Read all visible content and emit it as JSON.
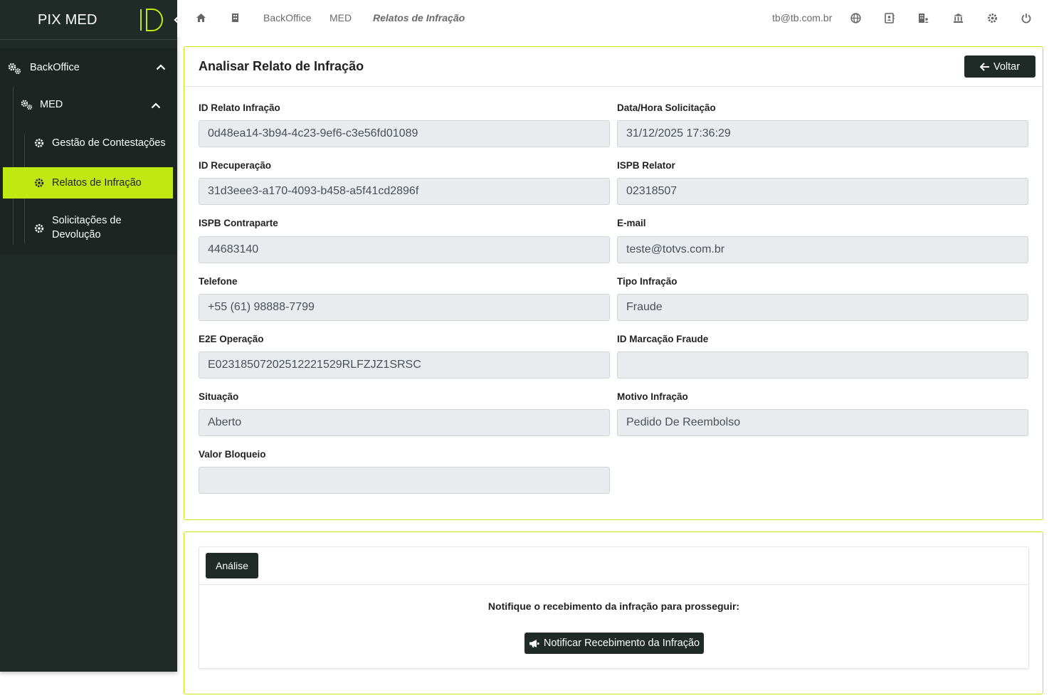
{
  "app": {
    "title": "PIX MED"
  },
  "sidebar": {
    "groups": [
      {
        "label": "BackOffice",
        "icon": "gears-icon",
        "expanded": true,
        "children": [
          {
            "label": "MED",
            "icon": "gears-icon",
            "expanded": true,
            "items": [
              {
                "label": "Gestão de Contestações",
                "icon": "gear-icon",
                "active": false
              },
              {
                "label": "Relatos de Infração",
                "icon": "gear-icon",
                "active": true
              },
              {
                "label": "Solicitações de Devolução",
                "icon": "gear-icon",
                "active": false
              }
            ]
          }
        ]
      }
    ]
  },
  "topbar": {
    "breadcrumb": [
      "BackOffice",
      "MED",
      "Relatos de Infração"
    ],
    "user_email": "tb@tb.com.br",
    "icons": [
      "home-icon",
      "building-icon",
      "globe-icon",
      "contact-icon",
      "company-icon",
      "bank-icon",
      "gear-icon",
      "power-icon"
    ]
  },
  "detail": {
    "title": "Analisar Relato de Infração",
    "back_label": "Voltar",
    "fields": {
      "id_relato": {
        "label": "ID Relato Infração",
        "value": "0d48ea14-3b94-4c23-9ef6-c3e56fd01089"
      },
      "data_hora": {
        "label": "Data/Hora Solicitação",
        "value": "31/12/2025 17:36:29"
      },
      "id_recuperacao": {
        "label": "ID Recuperação",
        "value": "31d3eee3-a170-4093-b458-a5f41cd2896f"
      },
      "ispb_relator": {
        "label": "ISPB Relator",
        "value": "02318507"
      },
      "ispb_contraparte": {
        "label": "ISPB Contraparte",
        "value": "44683140"
      },
      "email": {
        "label": "E-mail",
        "value": "teste@totvs.com.br"
      },
      "telefone": {
        "label": "Telefone",
        "value": "+55 (61) 98888-7799"
      },
      "tipo_infracao": {
        "label": "Tipo Infração",
        "value": "Fraude"
      },
      "e2e": {
        "label": "E2E Operação",
        "value": "E02318507202512221529RLFZJZ1SRSC"
      },
      "id_marcacao": {
        "label": "ID Marcação Fraude",
        "value": ""
      },
      "situacao": {
        "label": "Situação",
        "value": "Aberto"
      },
      "motivo": {
        "label": "Motivo Infração",
        "value": "Pedido De Reembolso"
      },
      "valor_bloqueio": {
        "label": "Valor Bloqueio",
        "value": ""
      }
    }
  },
  "analysis": {
    "tab_label": "Análise",
    "message": "Notifique o recebimento da infração para prosseguir:",
    "notify_label": "Notificar Recebimento da Infração"
  },
  "colors": {
    "accent": "#c2e812",
    "sidebar_bg": "#202a26",
    "input_bg": "#e9ecef"
  }
}
